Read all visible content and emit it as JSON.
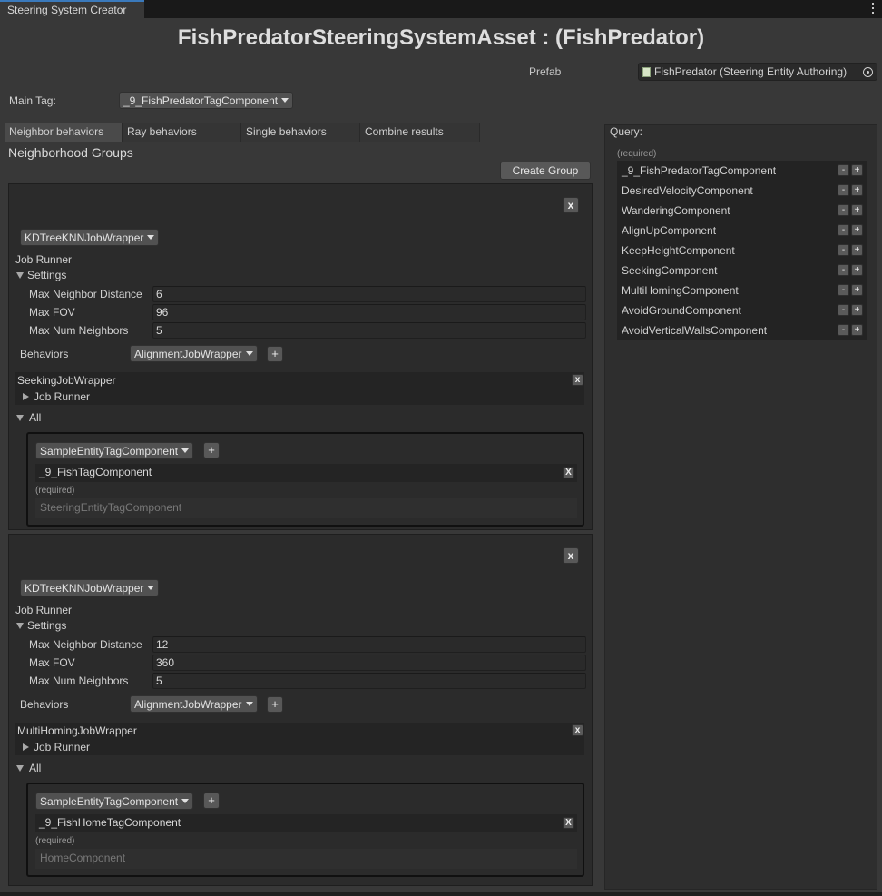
{
  "window": {
    "tab_title": "Steering System Creator",
    "menu_icon": "kebab-menu-icon"
  },
  "title": "FishPredatorSteeringSystemAsset :  (FishPredator)",
  "prefab": {
    "label": "Prefab",
    "value": "FishPredator (Steering Entity Authoring)"
  },
  "main_tag": {
    "label": "Main Tag:",
    "value": "_9_FishPredatorTagComponent"
  },
  "tabs": [
    "Neighbor behaviors",
    "Ray behaviors",
    "Single behaviors",
    "Combine results"
  ],
  "active_tab": "Neighbor behaviors",
  "neighborhood": {
    "header": "Neighborhood Groups",
    "create_label": "Create Group",
    "groups": [
      {
        "close": "x",
        "runner": "KDTreeKNNJobWrapper",
        "job_runner_label": "Job Runner",
        "settings_label": "Settings",
        "fields": [
          {
            "label": "Max Neighbor Distance",
            "value": "6"
          },
          {
            "label": "Max FOV",
            "value": "96"
          },
          {
            "label": "Max Num Neighbors",
            "value": "5"
          }
        ],
        "behaviors_label": "Behaviors",
        "behaviors_dropdown": "AlignmentJobWrapper",
        "plus": "+",
        "job": {
          "name": "SeekingJobWrapper",
          "close": "x",
          "runner_label": "Job Runner"
        },
        "all_label": "All",
        "query": {
          "dropdown": "SampleEntityTagComponent",
          "plus": "+",
          "tag": "_9_FishTagComponent",
          "tag_close": "X",
          "required_label": "(required)",
          "required_value": "SteeringEntityTagComponent"
        }
      },
      {
        "close": "x",
        "runner": "KDTreeKNNJobWrapper",
        "job_runner_label": "Job Runner",
        "settings_label": "Settings",
        "fields": [
          {
            "label": "Max Neighbor Distance",
            "value": "12"
          },
          {
            "label": "Max FOV",
            "value": "360"
          },
          {
            "label": "Max Num Neighbors",
            "value": "5"
          }
        ],
        "behaviors_label": "Behaviors",
        "behaviors_dropdown": "AlignmentJobWrapper",
        "plus": "+",
        "job": {
          "name": "MultiHomingJobWrapper",
          "close": "x",
          "runner_label": "Job Runner"
        },
        "all_label": "All",
        "query": {
          "dropdown": "SampleEntityTagComponent",
          "plus": "+",
          "tag": "_9_FishHomeTagComponent",
          "tag_close": "X",
          "required_label": "(required)",
          "required_value": "HomeComponent"
        }
      }
    ]
  },
  "query_panel": {
    "title": "Query:",
    "required_label": "(required)",
    "minus": "-",
    "plus": "+",
    "items": [
      "_9_FishPredatorTagComponent",
      "DesiredVelocityComponent",
      "WanderingComponent",
      "AlignUpComponent",
      "KeepHeightComponent",
      "SeekingComponent",
      "MultiHomingComponent",
      "AvoidGroundComponent",
      "AvoidVerticalWallsComponent"
    ]
  },
  "colors": {
    "background": "#383838",
    "panel": "#2b2b2b",
    "accent": "#3a79bb"
  }
}
